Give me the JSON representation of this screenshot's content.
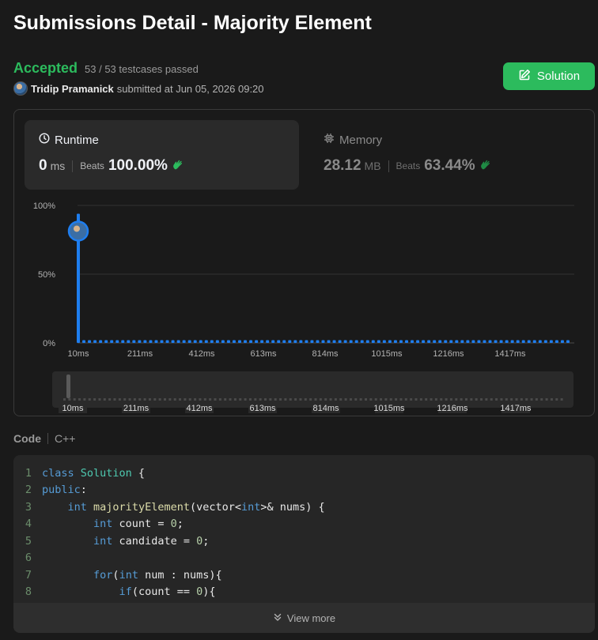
{
  "page": {
    "title": "Submissions Detail - Majority Element"
  },
  "status": {
    "label": "Accepted",
    "testcases": "53 / 53 testcases passed",
    "color": "#2cbb5d"
  },
  "submitter": {
    "name": "Tridip Pramanick",
    "submitted_at": "submitted at Jun 05, 2026 09:20"
  },
  "solution_button": {
    "label": "Solution",
    "icon": "edit-icon"
  },
  "runtime": {
    "title": "Runtime",
    "icon": "clock-icon",
    "value": "0",
    "unit": "ms",
    "beats_label": "Beats",
    "beats_value": "100.00%",
    "beats_icon": "clap-icon"
  },
  "memory": {
    "title": "Memory",
    "icon": "chip-icon",
    "value": "28.12",
    "unit": "MB",
    "beats_label": "Beats",
    "beats_value": "63.44%",
    "beats_icon": "clap-icon"
  },
  "chart_data": {
    "type": "bar",
    "y_ticks": [
      "100%",
      "50%",
      "0%"
    ],
    "ylim": [
      0,
      100
    ],
    "x_ticks": [
      "10ms",
      "211ms",
      "412ms",
      "613ms",
      "814ms",
      "1015ms",
      "1216ms",
      "1417ms"
    ],
    "series": [
      {
        "values": [
          94,
          2,
          2,
          2,
          2,
          2,
          2,
          2,
          2,
          2,
          2,
          2,
          2,
          2,
          2,
          2,
          2,
          2,
          2,
          2,
          2,
          2,
          2,
          2,
          2,
          2,
          2,
          2,
          2,
          2,
          2,
          2,
          2,
          2,
          2,
          2,
          2,
          2,
          2,
          2,
          2,
          2,
          2,
          2,
          2,
          2,
          2,
          2,
          2,
          2,
          2,
          2,
          2,
          2,
          2,
          2,
          2,
          2,
          2,
          2,
          2,
          2,
          2,
          2,
          2,
          2,
          2,
          2,
          2,
          2,
          2,
          2,
          2,
          2,
          2,
          2,
          2,
          2,
          2,
          2,
          2,
          2,
          2,
          2,
          2,
          2,
          2,
          2,
          2
        ]
      }
    ],
    "highlight_index": 0,
    "grid": true,
    "bar_color": "#1e7ef0",
    "navigator_ticks": [
      "10ms",
      "211ms",
      "412ms",
      "613ms",
      "814ms",
      "1015ms",
      "1216ms",
      "1417ms"
    ]
  },
  "code": {
    "label": "Code",
    "language": "C++",
    "lines": [
      {
        "n": "1",
        "tokens": [
          [
            "kw",
            "class"
          ],
          [
            "",
            ""
          ],
          [
            "ty",
            " Solution"
          ],
          [
            "",
            " {"
          ]
        ]
      },
      {
        "n": "2",
        "tokens": [
          [
            "kw",
            "public"
          ],
          [
            "",
            ":"
          ]
        ]
      },
      {
        "n": "3",
        "tokens": [
          [
            "",
            "    "
          ],
          [
            "kw",
            "int"
          ],
          [
            "",
            " "
          ],
          [
            "fn",
            "majorityElement"
          ],
          [
            "",
            "(vector<"
          ],
          [
            "kw",
            "int"
          ],
          [
            "",
            ">& nums) {"
          ]
        ]
      },
      {
        "n": "4",
        "tokens": [
          [
            "",
            "        "
          ],
          [
            "kw",
            "int"
          ],
          [
            "",
            " count = "
          ],
          [
            "num",
            "0"
          ],
          [
            "",
            ";"
          ]
        ]
      },
      {
        "n": "5",
        "tokens": [
          [
            "",
            "        "
          ],
          [
            "kw",
            "int"
          ],
          [
            "",
            " candidate = "
          ],
          [
            "num",
            "0"
          ],
          [
            "",
            ";"
          ]
        ]
      },
      {
        "n": "6",
        "tokens": []
      },
      {
        "n": "7",
        "tokens": [
          [
            "",
            "        "
          ],
          [
            "kw",
            "for"
          ],
          [
            "",
            "("
          ],
          [
            "kw",
            "int"
          ],
          [
            "",
            " num : nums){"
          ]
        ]
      },
      {
        "n": "8",
        "tokens": [
          [
            "",
            "            "
          ],
          [
            "kw",
            "if"
          ],
          [
            "",
            "(count == "
          ],
          [
            "num",
            "0"
          ],
          [
            "",
            "){"
          ]
        ]
      }
    ],
    "view_more": "View more"
  }
}
